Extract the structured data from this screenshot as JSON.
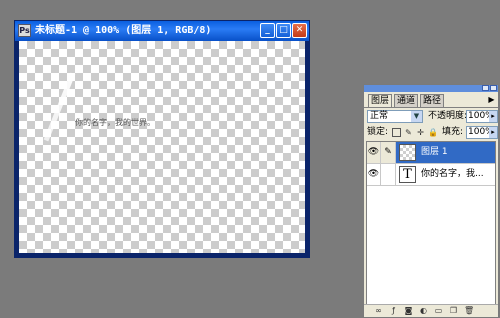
{
  "document_window": {
    "title": "未标题-1 @ 100% (图层 1, RGB/8)",
    "icons": {
      "app": "photoshop-doc-icon",
      "minimize": "minimize-icon",
      "maximize": "maximize-icon",
      "close": "close-icon"
    },
    "minimize_glyph": "_",
    "maximize_glyph": "□",
    "close_glyph": "✕",
    "canvas_text": "你的名字，我的世界。"
  },
  "layers_palette": {
    "tabs": [
      {
        "label": "图层",
        "active": true
      },
      {
        "label": "通道",
        "active": false
      },
      {
        "label": "路径",
        "active": false
      }
    ],
    "blend_mode": "正常",
    "opacity_label": "不透明度:",
    "opacity_value": "100%",
    "lock_label": "锁定:",
    "fill_label": "填充:",
    "fill_value": "100%",
    "layers": [
      {
        "name": "图层 1",
        "selected": true,
        "thumb": "transparent",
        "visible": true
      },
      {
        "name": "你的名字，我...",
        "selected": false,
        "thumb": "text",
        "thumb_glyph": "T",
        "visible": true
      }
    ],
    "bottom_icons": [
      "link-layers-icon",
      "layer-style-icon",
      "layer-mask-icon",
      "adjustment-layer-icon",
      "new-group-icon",
      "new-layer-icon",
      "delete-layer-icon"
    ]
  },
  "colors": {
    "titlebar": "#0a5fe0",
    "selected_layer": "#316ac5",
    "workspace": "#7b7b7b"
  }
}
